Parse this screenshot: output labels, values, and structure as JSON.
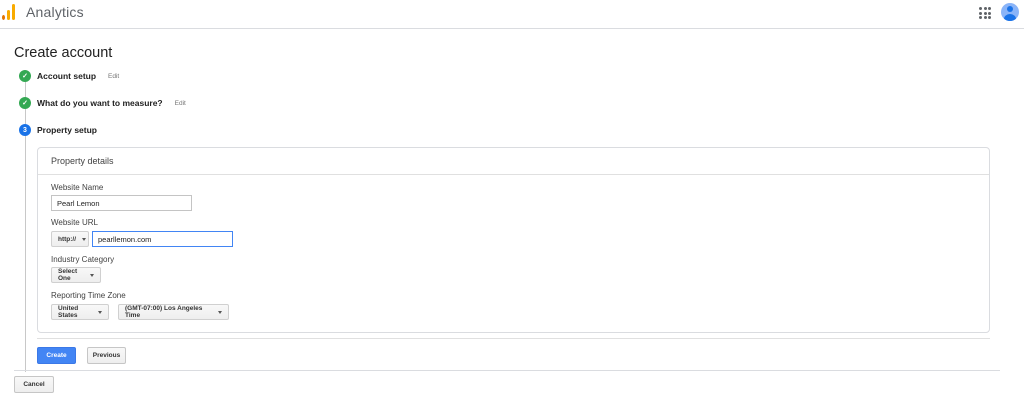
{
  "app": {
    "title": "Analytics",
    "logo_colors": [
      "#e37400",
      "#f9ab00"
    ],
    "apps_icon": "apps-grid-icon",
    "avatar_icon": "account-avatar-icon"
  },
  "page": {
    "title": "Create account"
  },
  "steps": [
    {
      "label": "Account setup",
      "status": "done",
      "edit": "Edit",
      "icon": "check-circle-icon"
    },
    {
      "label": "What do you want to measure?",
      "status": "done",
      "edit": "Edit",
      "icon": "check-circle-icon"
    },
    {
      "label": "Property setup",
      "status": "active",
      "number": "3",
      "icon": "step-number-icon"
    }
  ],
  "property_details": {
    "header": "Property details",
    "website_name": {
      "label": "Website Name",
      "value": "Pearl Lemon"
    },
    "website_url": {
      "label": "Website URL",
      "protocol": "http://",
      "value": "pearllemon.com"
    },
    "industry_category": {
      "label": "Industry Category",
      "selected": "Select One"
    },
    "reporting_time_zone": {
      "label": "Reporting Time Zone",
      "country": "United States",
      "zone": "(GMT-07:00) Los Angeles Time"
    }
  },
  "actions": {
    "create": "Create",
    "previous": "Previous",
    "cancel": "Cancel"
  },
  "colors": {
    "accent": "#4285f4",
    "success": "#34a853",
    "active_step": "#1a73e8"
  }
}
